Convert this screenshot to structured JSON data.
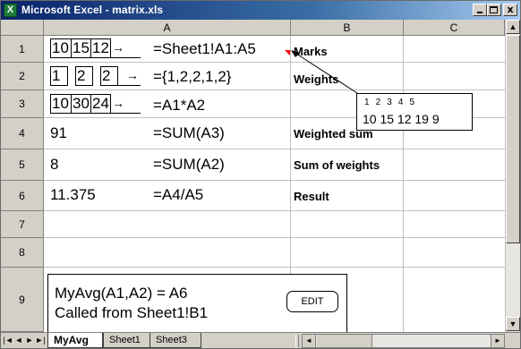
{
  "window": {
    "title": "Microsoft Excel - matrix.xls",
    "app_icon_label": "X",
    "controls": {
      "minimize": "_",
      "maximize": "□",
      "close": "x"
    }
  },
  "grid": {
    "columns": [
      "A",
      "B",
      "C"
    ],
    "rows": [
      "1",
      "2",
      "3",
      "4",
      "5",
      "6",
      "7",
      "8",
      "9"
    ],
    "row1": {
      "boxes": [
        "10",
        "15",
        "12"
      ],
      "formula": "=Sheet1!A1:A5",
      "label": "Marks"
    },
    "row2": {
      "boxes": [
        "1",
        "2",
        "2"
      ],
      "formula": "={1,2,2,1,2}",
      "label": "Weights"
    },
    "row3": {
      "boxes": [
        "10",
        "30",
        "24"
      ],
      "formula": "=A1*A2"
    },
    "row4": {
      "value": "91",
      "formula": "=SUM(A3)",
      "label": "Weighted sum"
    },
    "row5": {
      "value": "8",
      "formula": "=SUM(A2)",
      "label": "Sum of weights"
    },
    "row6": {
      "value": "11.375",
      "formula": "=A4/A5",
      "label": "Result"
    }
  },
  "callout": {
    "top_numbers": "1  2  3  4  5",
    "bottom_numbers": "10 15 12 19 9"
  },
  "function_box": {
    "line1": "MyAvg(A1,A2) = A6",
    "line2": "Called from Sheet1!B1",
    "edit_button": "EDIT"
  },
  "sheet_tabs": {
    "active": "MyAvg",
    "tabs": [
      "MyAvg",
      "Sheet1",
      "Sheet3"
    ]
  },
  "icons": {
    "nav_first": "|◄",
    "nav_prev": "◄",
    "nav_next": "►",
    "nav_last": "►|",
    "scroll_up": "▲",
    "scroll_down": "▼",
    "scroll_left": "◄",
    "scroll_right": "►",
    "arrow": "→"
  },
  "colors": {
    "titlebar_start": "#0a246a",
    "titlebar_end": "#a6caf0",
    "chrome": "#d4d0c8",
    "gridline": "#c0c0c0"
  }
}
